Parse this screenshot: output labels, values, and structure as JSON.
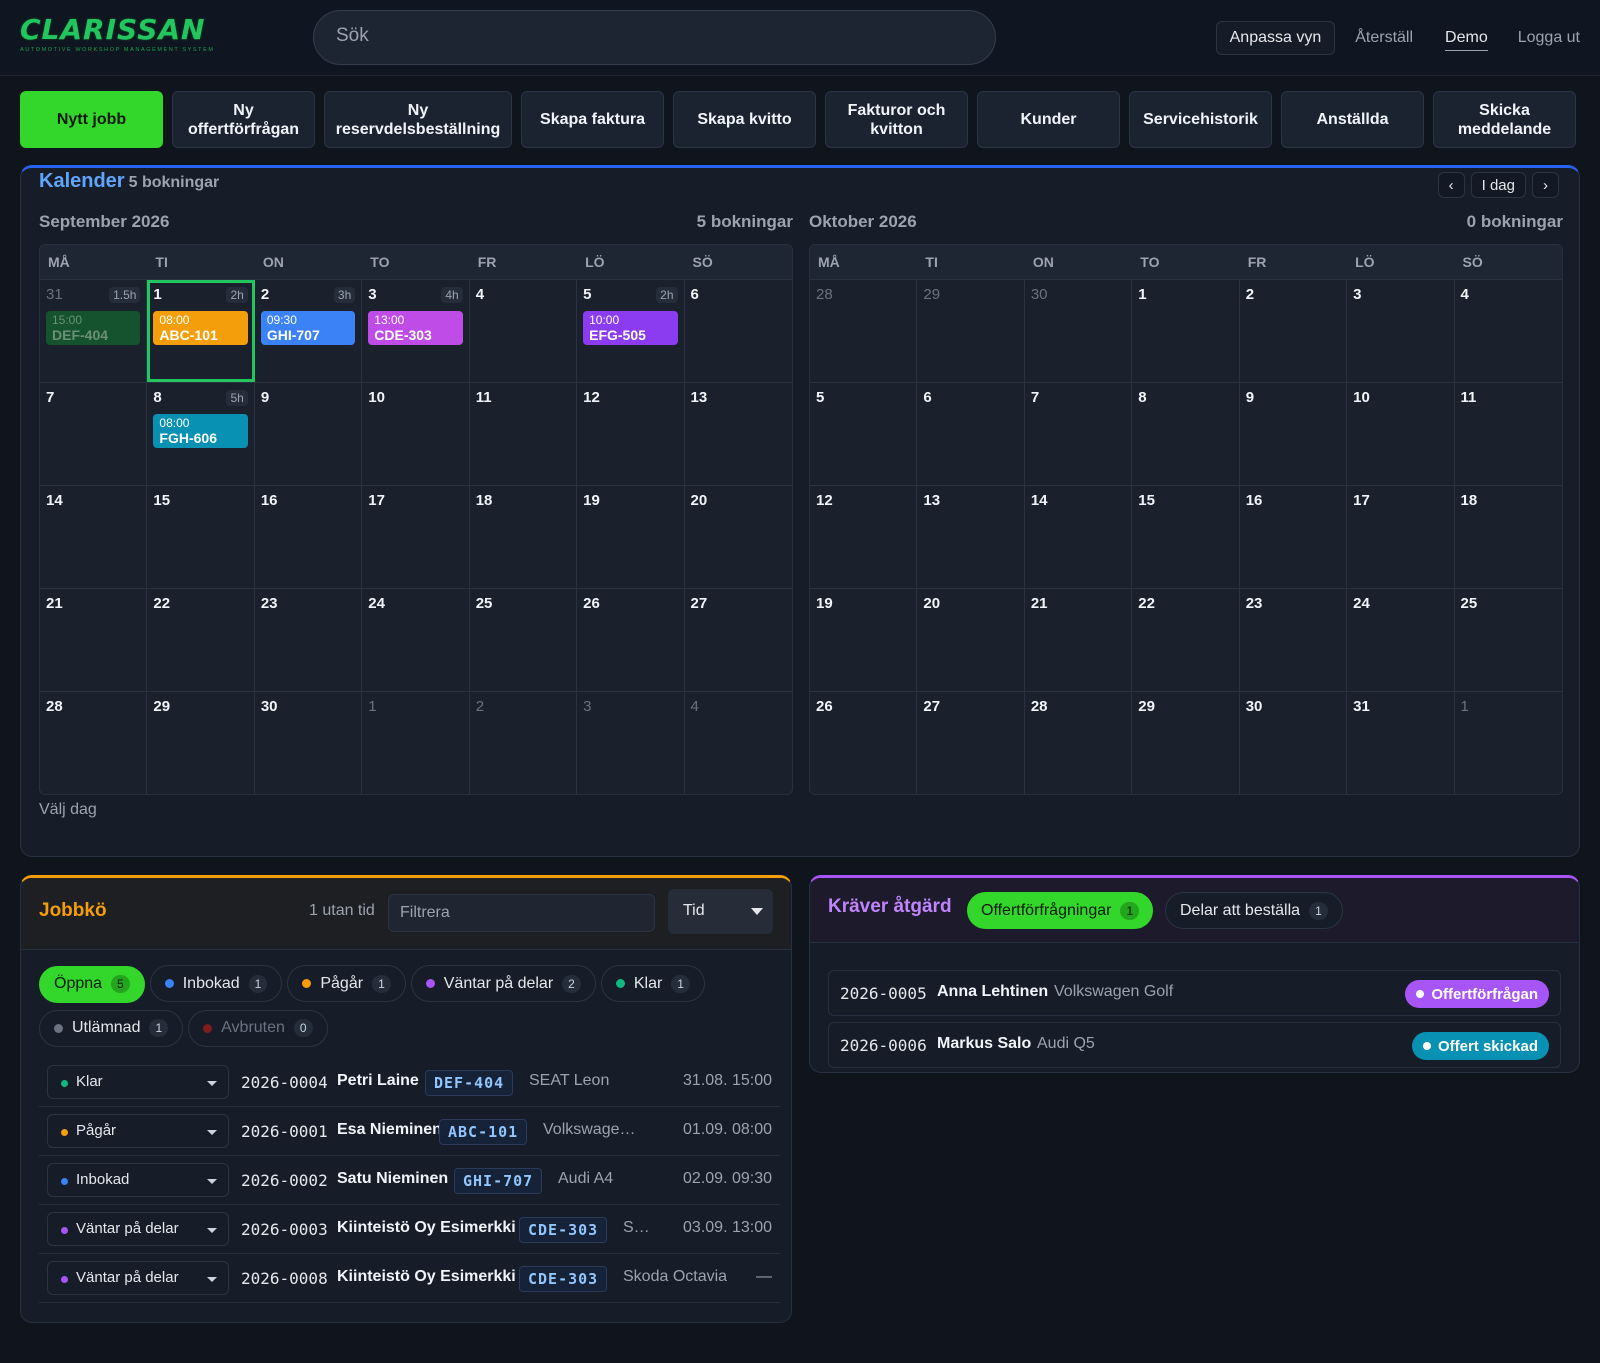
{
  "app": {
    "logo": "CLARISSAN",
    "logo_sub": "AUTOMOTIVE WORKSHOP MANAGEMENT SYSTEM",
    "search_placeholder": "Sök",
    "customize": "Anpassa vyn",
    "reset": "Återställ",
    "user": "Demo",
    "logout": "Logga ut"
  },
  "actions": [
    "Nytt jobb",
    "Ny offertförfrågan",
    "Ny reservdelsbeställning",
    "Skapa faktura",
    "Skapa kvitto",
    "Fakturor och kvitton",
    "Kunder",
    "Servicehistorik",
    "Anställda",
    "Skicka meddelande"
  ],
  "calendar": {
    "title": "Kalender",
    "count": "5 bokningar",
    "prev": "‹",
    "today": "I dag",
    "next": "›",
    "select_day": "Välj dag",
    "dow": [
      "MÅ",
      "TI",
      "ON",
      "TO",
      "FR",
      "LÖ",
      "SÖ"
    ],
    "months": [
      {
        "name": "September 2026",
        "count": "5 bokningar",
        "weeks": [
          [
            {
              "d": "31",
              "dim": true,
              "dur": "1.5h",
              "ev": {
                "time": "15:00",
                "plate": "DEF-404",
                "color": "#14532d",
                "faded": true
              }
            },
            {
              "d": "1",
              "today": true,
              "dur": "2h",
              "ev": {
                "time": "08:00",
                "plate": "ABC-101",
                "color": "#f59e0b"
              }
            },
            {
              "d": "2",
              "dur": "3h",
              "ev": {
                "time": "09:30",
                "plate": "GHI-707",
                "color": "#3b82f6"
              }
            },
            {
              "d": "3",
              "dur": "4h",
              "ev": {
                "time": "13:00",
                "plate": "CDE-303",
                "color": "#c04ce8"
              }
            },
            {
              "d": "4"
            },
            {
              "d": "5",
              "dur": "2h",
              "ev": {
                "time": "10:00",
                "plate": "EFG-505",
                "color": "#8b3cf0"
              }
            },
            {
              "d": "6"
            }
          ],
          [
            {
              "d": "7"
            },
            {
              "d": "8",
              "dur": "5h",
              "ev": {
                "time": "08:00",
                "plate": "FGH-606",
                "color": "#0891b2"
              }
            },
            {
              "d": "9"
            },
            {
              "d": "10"
            },
            {
              "d": "11"
            },
            {
              "d": "12"
            },
            {
              "d": "13"
            }
          ],
          [
            {
              "d": "14"
            },
            {
              "d": "15"
            },
            {
              "d": "16"
            },
            {
              "d": "17"
            },
            {
              "d": "18"
            },
            {
              "d": "19"
            },
            {
              "d": "20"
            }
          ],
          [
            {
              "d": "21"
            },
            {
              "d": "22"
            },
            {
              "d": "23"
            },
            {
              "d": "24"
            },
            {
              "d": "25"
            },
            {
              "d": "26"
            },
            {
              "d": "27"
            }
          ],
          [
            {
              "d": "28"
            },
            {
              "d": "29"
            },
            {
              "d": "30"
            },
            {
              "d": "1",
              "dim": true
            },
            {
              "d": "2",
              "dim": true
            },
            {
              "d": "3",
              "dim": true
            },
            {
              "d": "4",
              "dim": true
            }
          ]
        ]
      },
      {
        "name": "Oktober 2026",
        "count": "0 bokningar",
        "weeks": [
          [
            {
              "d": "28",
              "dim": true
            },
            {
              "d": "29",
              "dim": true
            },
            {
              "d": "30",
              "dim": true
            },
            {
              "d": "1"
            },
            {
              "d": "2"
            },
            {
              "d": "3"
            },
            {
              "d": "4"
            }
          ],
          [
            {
              "d": "5"
            },
            {
              "d": "6"
            },
            {
              "d": "7"
            },
            {
              "d": "8"
            },
            {
              "d": "9"
            },
            {
              "d": "10"
            },
            {
              "d": "11"
            }
          ],
          [
            {
              "d": "12"
            },
            {
              "d": "13"
            },
            {
              "d": "14"
            },
            {
              "d": "15"
            },
            {
              "d": "16"
            },
            {
              "d": "17"
            },
            {
              "d": "18"
            }
          ],
          [
            {
              "d": "19"
            },
            {
              "d": "20"
            },
            {
              "d": "21"
            },
            {
              "d": "22"
            },
            {
              "d": "23"
            },
            {
              "d": "24"
            },
            {
              "d": "25"
            }
          ],
          [
            {
              "d": "26"
            },
            {
              "d": "27"
            },
            {
              "d": "28"
            },
            {
              "d": "29"
            },
            {
              "d": "30"
            },
            {
              "d": "31"
            },
            {
              "d": "1",
              "dim": true
            }
          ]
        ]
      }
    ]
  },
  "queue": {
    "title": "Jobbkö",
    "no_time": "1 utan tid",
    "filter_placeholder": "Filtrera",
    "sort": "Tid",
    "chips": [
      {
        "label": "Öppna",
        "count": "5",
        "active": true
      },
      {
        "label": "Inbokad",
        "count": "1",
        "color": "#3b82f6"
      },
      {
        "label": "Pågår",
        "count": "1",
        "color": "#f59e0b"
      },
      {
        "label": "Väntar på delar",
        "count": "2",
        "color": "#a855f7"
      },
      {
        "label": "Klar",
        "count": "1",
        "color": "#10b981"
      },
      {
        "label": "Utlämnad",
        "count": "1",
        "color": "#6b7280"
      },
      {
        "label": "Avbruten",
        "count": "0",
        "color": "#7f1d1d",
        "dim": true
      }
    ],
    "jobs": [
      {
        "status": "Klar",
        "color": "#10b981",
        "id": "2026-0004",
        "name": "Petri Laine",
        "plate": "DEF-404",
        "car": "SEAT Leon",
        "time": "31.08. 15:00"
      },
      {
        "status": "Pågår",
        "color": "#f59e0b",
        "id": "2026-0001",
        "name": "Esa Nieminen",
        "plate": "ABC-101",
        "car": "Volkswagen Golf",
        "time": "01.09. 08:00"
      },
      {
        "status": "Inbokad",
        "color": "#3b82f6",
        "id": "2026-0002",
        "name": "Satu Nieminen",
        "plate": "GHI-707",
        "car": "Audi A4",
        "time": "02.09. 09:30"
      },
      {
        "status": "Väntar på delar",
        "color": "#a855f7",
        "id": "2026-0003",
        "name": "Kiinteistö Oy Esimerkki",
        "plate": "CDE-303",
        "car": "Skoda Octavia",
        "time": "03.09. 13:00"
      },
      {
        "status": "Väntar på delar",
        "color": "#a855f7",
        "id": "2026-0008",
        "name": "Kiinteistö Oy Esimerkki",
        "plate": "CDE-303",
        "car": "Skoda Octavia",
        "time": "—"
      }
    ]
  },
  "action_panel": {
    "title": "Kräver åtgärd",
    "tab_quotes": "Offertförfrågningar",
    "tab_quotes_count": "1",
    "tab_parts": "Delar att beställa",
    "tab_parts_count": "1",
    "items": [
      {
        "id": "2026-0005",
        "name": "Anna Lehtinen",
        "car": "Volkswagen Golf",
        "badge": "Offertförfrågan",
        "color": "#a855f7"
      },
      {
        "id": "2026-0006",
        "name": "Markus Salo",
        "car": "Audi Q5",
        "badge": "Offert skickad",
        "color": "#0891b2"
      }
    ]
  }
}
